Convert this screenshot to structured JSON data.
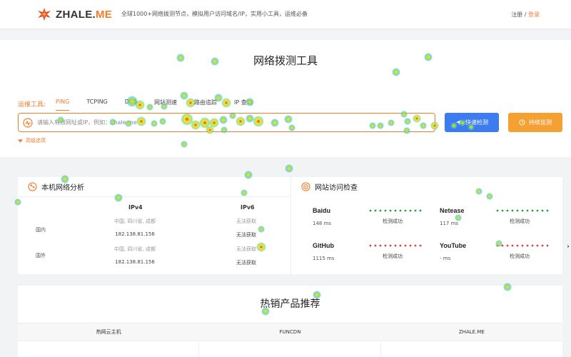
{
  "header": {
    "brand_main": "ZHALE.",
    "brand_accent": "ME",
    "tagline": "全球1000+网络拨测节点，模拟用户访问域名/IP，实用小工具，运维必备",
    "register": "注册",
    "separator": " / ",
    "login": "登录"
  },
  "tool": {
    "title": "网络拨测工具",
    "label": "运维工具:",
    "tabs": [
      {
        "label": "PING",
        "active": true
      },
      {
        "label": "TCPING",
        "active": false
      },
      {
        "label": "DNS",
        "active": false
      },
      {
        "label": "网站测速",
        "active": false
      },
      {
        "label": "路由追踪",
        "active": false
      },
      {
        "label": "IP 查询",
        "active": false
      }
    ],
    "search_placeholder": "请输入有效网址或IP，例如：zhale.me",
    "quick_button": "快速检测",
    "continuous_button": "持续监测",
    "advanced": "高级选项"
  },
  "local": {
    "title": "本机网络分析",
    "col_ipv4": "IPv4",
    "col_ipv6": "IPv6",
    "rows": [
      {
        "label": "国内",
        "ipv4_loc": "中国, 四川省, 成都",
        "ipv4_ip": "182.138.81.156",
        "ipv6_loc": "无法获取",
        "ipv6_ip": "无法获取"
      },
      {
        "label": "国外",
        "ipv4_loc": "中国, 四川省, 成都",
        "ipv4_ip": "182.138.81.156",
        "ipv6_loc": "无法获取",
        "ipv6_ip": "无法获取"
      }
    ]
  },
  "sites": {
    "title": "网站访问检查",
    "items": [
      {
        "name": "Baidu",
        "ms": "148 ms",
        "status": "检测成功",
        "color": "#2e9a3a"
      },
      {
        "name": "Netease",
        "ms": "117 ms",
        "status": "检测成功",
        "color": "#2e9a3a"
      },
      {
        "name": "GitHub",
        "ms": "1115 ms",
        "status": "检测成功",
        "color": "#e23c3c"
      },
      {
        "name": "YouTube",
        "ms": "- ms",
        "status": "检测成功",
        "color": "#e23c3c"
      }
    ]
  },
  "products": {
    "title": "热销产品推荐",
    "tabs": [
      "热网云主机",
      "FUNCDN",
      "ZHALE.ME"
    ]
  },
  "colors": {
    "accent": "#f07c2e",
    "primary_button": "#3c7bf0",
    "secondary_button": "#f5a033"
  }
}
